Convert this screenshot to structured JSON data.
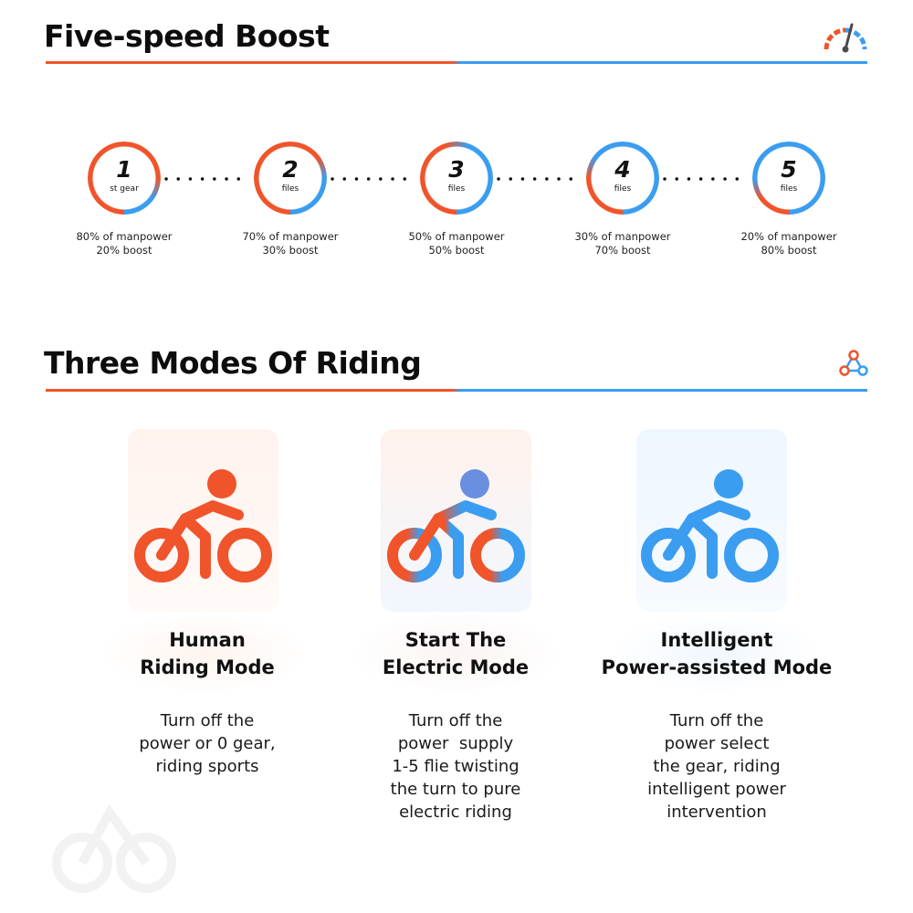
{
  "sections": {
    "boost": {
      "title": "Five-speed Boost",
      "icon": "speedometer-icon"
    },
    "modes": {
      "title": "Three Modes Of Riding",
      "icon": "network-nodes-icon"
    }
  },
  "colors": {
    "orange": "#f0542a",
    "blue": "#3a9df0"
  },
  "gears": [
    {
      "number": "1",
      "label": "st gear",
      "line1": "80% of manpower",
      "line2": "20% boost",
      "boost": 0.2
    },
    {
      "number": "2",
      "label": "files",
      "line1": "70% of manpower",
      "line2": "30% boost",
      "boost": 0.3
    },
    {
      "number": "3",
      "label": "files",
      "line1": "50% of manpower",
      "line2": "50% boost",
      "boost": 0.5
    },
    {
      "number": "4",
      "label": "files",
      "line1": "30% of manpower",
      "line2": "70% boost",
      "boost": 0.7
    },
    {
      "number": "5",
      "label": "files",
      "line1": "20% of manpower",
      "line2": "80% boost",
      "boost": 0.8
    }
  ],
  "modes": [
    {
      "icon": "cyclist-icon",
      "title1": "Human",
      "title2": "Riding Mode",
      "desc": [
        "Turn off the",
        "power or 0 gear,",
        "riding sports"
      ]
    },
    {
      "icon": "cyclist-icon",
      "title1": "Start The",
      "title2": "Electric Mode",
      "desc": [
        "Turn off the",
        "power  supply",
        "1-5 flie twisting",
        "the turn to pure",
        "electric riding"
      ]
    },
    {
      "icon": "cyclist-icon",
      "title1": "Intelligent",
      "title2": "Power-assisted Mode",
      "desc": [
        "Turn off the",
        "power select",
        "the gear, riding",
        "intelligent power",
        "intervention"
      ]
    }
  ]
}
